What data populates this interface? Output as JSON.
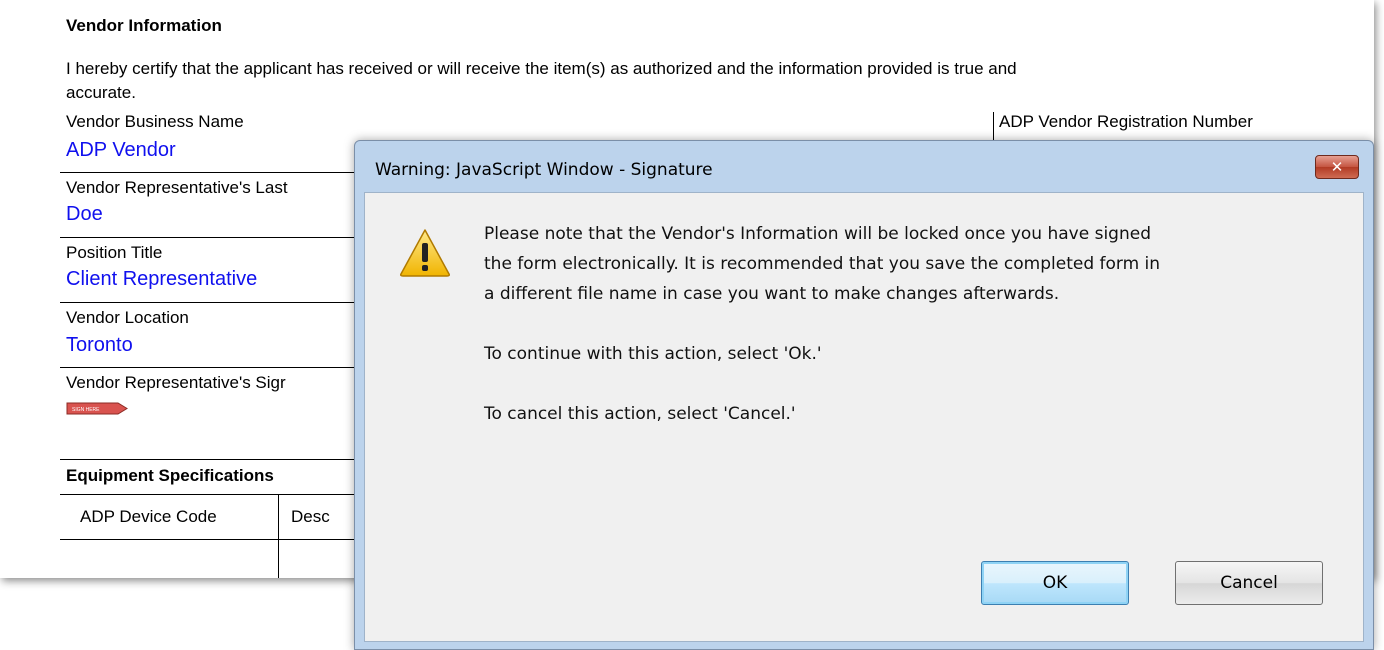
{
  "form": {
    "section_title": "Vendor Information",
    "certification_text_line1": "I hereby certify that the applicant has received or will receive the item(s) as authorized and the information provided is true and",
    "certification_text_line2": "accurate.",
    "fields": {
      "business_name_label": "Vendor Business Name",
      "business_name_value": "ADP Vendor",
      "registration_number_label": "ADP Vendor Registration Number",
      "rep_last_name_label": "Vendor Representative's Last",
      "rep_last_name_value": "Doe",
      "position_title_label": "Position Title",
      "position_title_value": "Client Representative",
      "location_label": "Vendor Location",
      "location_value": "Toronto",
      "signature_label": "Vendor Representative's Sigr",
      "sign_here_tag": "SIGN HERE"
    },
    "equipment": {
      "title": "Equipment Specifications",
      "col_device_code": "ADP Device Code",
      "col_description": "Desc"
    }
  },
  "dialog": {
    "title": "Warning: JavaScript Window - Signature",
    "close_label": "✕",
    "icon": "warning-icon",
    "message_line1": "Please note that the Vendor's Information will be locked once you have signed",
    "message_line2": "the form electronically. It is recommended that you save the completed form in",
    "message_line3": "a different file name in case you want to make changes afterwards.",
    "continue_text": "To continue with this action, select 'Ok.'",
    "cancel_text": "To cancel this action, select 'Cancel.'",
    "ok_label": "OK",
    "cancel_label": "Cancel"
  },
  "colors": {
    "value_text": "#1010ee",
    "dialog_frame": "#bcd3ec",
    "dialog_body": "#f0f0f0",
    "close_button": "#c45440",
    "sign_tag": "#d9534f"
  }
}
